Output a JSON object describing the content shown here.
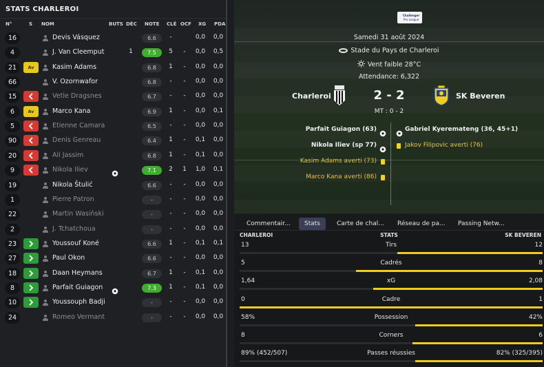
{
  "left_panel": {
    "title": "STATS CHARLEROI",
    "columns": {
      "num": "N°",
      "s": "S",
      "name": "NOM",
      "goals": "BUTS",
      "dec": "DÉC",
      "rating": "NOTE",
      "key": "CLÉ",
      "ocf": "OCF",
      "xg": "XG",
      "pda": "PDA"
    },
    "players": [
      {
        "num": "16",
        "status": "",
        "name": "Devis Vásquez",
        "dim": false,
        "goal": false,
        "buts": "",
        "dec": "",
        "rating": "6.6",
        "hi": false,
        "key": "-",
        "ocf": "",
        "xg": "0,0",
        "pda": "0,0"
      },
      {
        "num": "4",
        "status": "",
        "name": "J. Van Cleemput",
        "dim": false,
        "goal": false,
        "buts": "",
        "dec": "1",
        "rating": "7.5",
        "hi": true,
        "key": "5",
        "ocf": "-",
        "xg": "0,0",
        "pda": "0,5"
      },
      {
        "num": "21",
        "status": "av",
        "name": "Kasim Adams",
        "dim": false,
        "goal": false,
        "buts": "",
        "dec": "",
        "rating": "6.8",
        "hi": false,
        "key": "1",
        "ocf": "-",
        "xg": "0,0",
        "pda": "0,0"
      },
      {
        "num": "66",
        "status": "",
        "name": "V. Ozornwafor",
        "dim": false,
        "goal": false,
        "buts": "",
        "dec": "",
        "rating": "6.8",
        "hi": false,
        "key": "-",
        "ocf": "-",
        "xg": "0,0",
        "pda": "0,0"
      },
      {
        "num": "15",
        "status": "out",
        "name": "Vetle Dragsnes",
        "dim": true,
        "goal": false,
        "buts": "",
        "dec": "",
        "rating": "6.7",
        "hi": false,
        "key": "-",
        "ocf": "-",
        "xg": "0,0",
        "pda": "0,0"
      },
      {
        "num": "6",
        "status": "av",
        "name": "Marco Kana",
        "dim": false,
        "goal": false,
        "buts": "",
        "dec": "",
        "rating": "6.9",
        "hi": false,
        "key": "1",
        "ocf": "-",
        "xg": "0,0",
        "pda": "0,1"
      },
      {
        "num": "5",
        "status": "out",
        "name": "Etienne Camara",
        "dim": true,
        "goal": false,
        "buts": "",
        "dec": "",
        "rating": "6.5",
        "hi": false,
        "key": "-",
        "ocf": "-",
        "xg": "0,0",
        "pda": "0,0"
      },
      {
        "num": "90",
        "status": "out",
        "name": "Denis Genreau",
        "dim": true,
        "goal": false,
        "buts": "",
        "dec": "",
        "rating": "6.4",
        "hi": false,
        "key": "1",
        "ocf": "-",
        "xg": "0,1",
        "pda": "0,0"
      },
      {
        "num": "20",
        "status": "out",
        "name": "Ali Jassim",
        "dim": true,
        "goal": false,
        "buts": "",
        "dec": "",
        "rating": "6.8",
        "hi": false,
        "key": "1",
        "ocf": "-",
        "xg": "0,1",
        "pda": "0,0"
      },
      {
        "num": "9",
        "status": "out",
        "name": "Nikola Iliev",
        "dim": true,
        "goal": true,
        "buts": "",
        "dec": "",
        "rating": "7.1",
        "hi": true,
        "key": "2",
        "ocf": "1",
        "xg": "1,0",
        "pda": "0,1"
      },
      {
        "num": "19",
        "status": "",
        "name": "Nikola Štulić",
        "dim": false,
        "goal": false,
        "buts": "",
        "dec": "",
        "rating": "6.6",
        "hi": false,
        "key": "-",
        "ocf": "-",
        "xg": "0,0",
        "pda": "0,0"
      },
      {
        "num": "1",
        "status": "",
        "name": "Pierre Patron",
        "dim": true,
        "goal": false,
        "buts": "",
        "dec": "",
        "rating": "-",
        "hi": false,
        "key": "-",
        "ocf": "-",
        "xg": "0,0",
        "pda": "0,0"
      },
      {
        "num": "22",
        "status": "",
        "name": "Martin Wasiński",
        "dim": true,
        "goal": false,
        "buts": "",
        "dec": "",
        "rating": "-",
        "hi": false,
        "key": "-",
        "ocf": "-",
        "xg": "0,0",
        "pda": "0,0"
      },
      {
        "num": "2",
        "status": "",
        "name": "J. Tchatchoua",
        "dim": true,
        "goal": false,
        "buts": "",
        "dec": "",
        "rating": "-",
        "hi": false,
        "key": "-",
        "ocf": "-",
        "xg": "0,0",
        "pda": "0,0"
      },
      {
        "num": "23",
        "status": "in",
        "name": "Youssouf Koné",
        "dim": false,
        "goal": false,
        "buts": "",
        "dec": "",
        "rating": "6.6",
        "hi": false,
        "key": "1",
        "ocf": "-",
        "xg": "0,1",
        "pda": "0,1"
      },
      {
        "num": "27",
        "status": "in",
        "name": "Paul Okon",
        "dim": false,
        "goal": false,
        "buts": "",
        "dec": "",
        "rating": "6.6",
        "hi": false,
        "key": "-",
        "ocf": "-",
        "xg": "0,0",
        "pda": "0,0"
      },
      {
        "num": "18",
        "status": "in",
        "name": "Daan Heymans",
        "dim": false,
        "goal": false,
        "buts": "",
        "dec": "",
        "rating": "6.7",
        "hi": false,
        "key": "1",
        "ocf": "-",
        "xg": "0,1",
        "pda": "0,0"
      },
      {
        "num": "8",
        "status": "in",
        "name": "Parfait Guiagon",
        "dim": false,
        "goal": true,
        "buts": "",
        "dec": "",
        "rating": "7.3",
        "hi": true,
        "key": "1",
        "ocf": "-",
        "xg": "0,1",
        "pda": "0,0"
      },
      {
        "num": "10",
        "status": "in",
        "name": "Youssouph Badji",
        "dim": false,
        "goal": false,
        "buts": "",
        "dec": "",
        "rating": "-",
        "hi": false,
        "key": "-",
        "ocf": "-",
        "xg": "0,0",
        "pda": "0,0"
      },
      {
        "num": "24",
        "status": "",
        "name": "Romeo Vermant",
        "dim": true,
        "goal": false,
        "buts": "",
        "dec": "",
        "rating": "-",
        "hi": false,
        "key": "-",
        "ocf": "-",
        "xg": "0,0",
        "pda": "0,0"
      }
    ]
  },
  "match": {
    "league_line1": "Challenger",
    "league_line2": "Pro League",
    "date": "Samedi 31 août 2024",
    "stadium": "Stade du Pays de Charleroi",
    "weather": "Vent faible 28°C",
    "attendance": "Attendance: 6,322",
    "home": "Charleroi",
    "away": "SK Beveren",
    "score": "2 - 2",
    "halftime": "MT : 0 - 2",
    "home_events": [
      {
        "text": "Parfait Guiagon (63)",
        "type": "goal"
      },
      {
        "text": "Nikola Iliev (sp 77)",
        "type": "goal"
      },
      {
        "text": "Kasim Adams averti (73)",
        "type": "card"
      },
      {
        "text": "Marco Kana averti (86)",
        "type": "card"
      }
    ],
    "away_events": [
      {
        "text": "Gabriel Kyeremateng (36, 45+1)",
        "type": "goal"
      },
      {
        "text": "Jakov Filipovic averti (76)",
        "type": "card"
      }
    ]
  },
  "tabs": [
    "Commentair...",
    "Stats",
    "Carte de chal...",
    "Réseau de pa...",
    "Passing Netw..."
  ],
  "active_tab": 1,
  "stats_header": {
    "home": "CHARLEROI",
    "title": "STATS",
    "away": "SK BEVEREN"
  },
  "stats": [
    {
      "label": "Tirs",
      "home": "13",
      "away": "12",
      "home_share": 0.52
    },
    {
      "label": "Cadrés",
      "home": "5",
      "away": "8",
      "home_share": 0.385
    },
    {
      "label": "xG",
      "home": "1,64",
      "away": "2,08",
      "home_share": 0.44
    },
    {
      "label": "Cadre",
      "home": "0",
      "away": "1",
      "home_share": 0.0
    },
    {
      "label": "Possession",
      "home": "58%",
      "away": "42%",
      "home_share": 0.58
    },
    {
      "label": "Corners",
      "home": "8",
      "away": "6",
      "home_share": 0.571
    },
    {
      "label": "Passes réussies",
      "home": "89% (452/507)",
      "away": "82% (325/395)",
      "home_share": 0.58
    }
  ],
  "colors": {
    "accent_yellow": "#f0cd1c",
    "rating_green": "#3fae2f",
    "sub_out_red": "#d63a32",
    "sub_in_green": "#2e9b3a",
    "active_tab": "#3a3f55"
  }
}
